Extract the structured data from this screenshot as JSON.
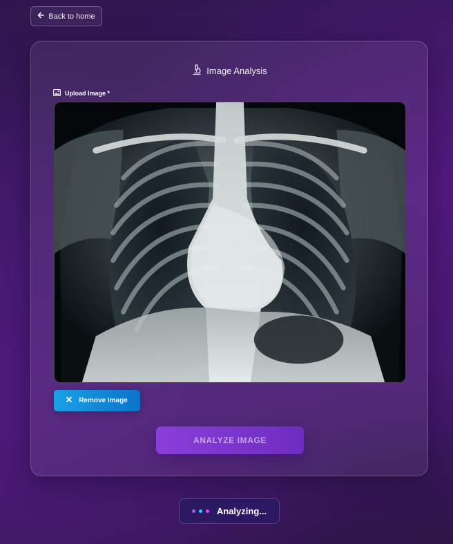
{
  "nav": {
    "back_label": "Back to home",
    "back_icon": "arrow-left-icon"
  },
  "card": {
    "title": "Image Analysis",
    "title_icon": "microscope-icon",
    "upload_label": "Upload Image *",
    "upload_icon": "image-icon",
    "preview_alt": "Uploaded chest X-ray",
    "remove_label": "Remove Image",
    "remove_icon": "close-icon",
    "analyze_label": "ANALYZE IMAGE"
  },
  "status": {
    "text": "Analyzing...",
    "dot_colors": [
      "#a855f7",
      "#22d3ee",
      "#d946ef"
    ]
  },
  "colors": {
    "accent": "#7c3aed",
    "remove_button": "#0b84d8"
  }
}
